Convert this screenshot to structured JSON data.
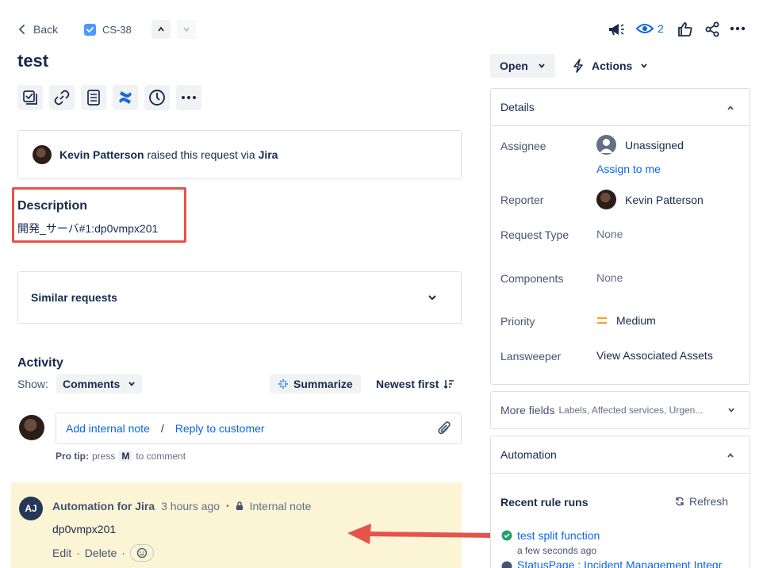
{
  "nav": {
    "back_label": "Back",
    "issue_key": "CS-38",
    "watch_count": "2"
  },
  "issue": {
    "title": "test",
    "raised_by_name": "Kevin Patterson",
    "raised_text": "raised this request via",
    "raised_via": "Jira"
  },
  "description": {
    "heading": "Description",
    "text": "開発_サーバ#1:dp0vmpx201"
  },
  "similar": {
    "label": "Similar requests"
  },
  "activity": {
    "heading": "Activity",
    "show_label": "Show:",
    "filter_value": "Comments",
    "summarize_label": "Summarize",
    "sort_label": "Newest first",
    "add_internal_note": "Add internal note",
    "separator": "/",
    "reply_customer": "Reply to customer",
    "pro_tip_label": "Pro tip:",
    "pro_tip_press": "press",
    "pro_tip_key": "M",
    "pro_tip_rest": "to comment"
  },
  "comment": {
    "avatar_initials": "AJ",
    "author": "Automation for Jira",
    "time": "3 hours ago",
    "dot": "•",
    "visibility": "Internal note",
    "body": "dp0vmpx201",
    "edit_label": "Edit",
    "delete_label": "Delete",
    "sep": "·"
  },
  "status": {
    "status_label": "Open",
    "actions_label": "Actions"
  },
  "details": {
    "heading": "Details",
    "rows": [
      {
        "label": "Assignee",
        "value": "Unassigned",
        "extra": "Assign to me"
      },
      {
        "label": "Reporter",
        "value": "Kevin Patterson"
      },
      {
        "label": "Request Type",
        "value": "None"
      },
      {
        "label": "Components",
        "value": "None"
      },
      {
        "label": "Priority",
        "value": "Medium"
      },
      {
        "label": "Lansweeper",
        "value": "View Associated Assets"
      }
    ]
  },
  "more_fields": {
    "label": "More fields",
    "summary": "Labels, Affected services, Urgen..."
  },
  "automation": {
    "heading": "Automation",
    "recent_label": "Recent rule runs",
    "refresh_label": "Refresh",
    "runs": [
      {
        "name": "test split function",
        "time": "a few seconds ago"
      },
      {
        "name": "StatusPage : Incident Management Integr"
      }
    ]
  },
  "colors": {
    "link": "#0c66e4",
    "highlight_box": "#e5534b",
    "comment_bg": "#fbf5d6",
    "priority_medium": "#f5a623",
    "success": "#22a06b"
  }
}
